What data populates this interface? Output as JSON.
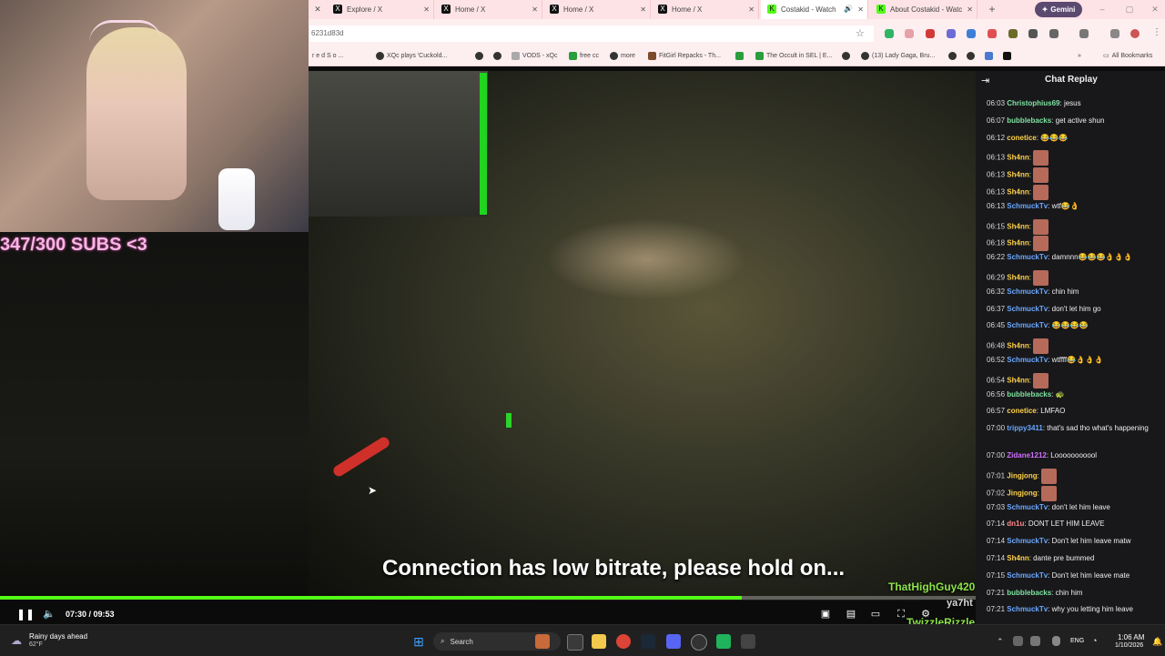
{
  "browser": {
    "tabs": [
      {
        "label": "Explore / X",
        "favicon": "x-icon"
      },
      {
        "label": "Home / X",
        "favicon": "x-icon"
      },
      {
        "label": "Home / X",
        "favicon": "x-icon"
      },
      {
        "label": "Home / X",
        "favicon": "x-icon"
      },
      {
        "label": "Costakid - Watch",
        "favicon": "kick-icon",
        "active": true
      },
      {
        "label": "About Costakid - Watc",
        "favicon": "kick-icon"
      }
    ],
    "gemini_label": "Gemini",
    "url_fragment": "6231d83d",
    "bookmarks": [
      "r e d   S o ...",
      "XQc plays 'Cuckold...",
      "VODS - xQc",
      "free cc",
      "more",
      "FitGirl Repacks - Th...",
      "The Occult in SEL | E...",
      "(13) Lady Gaga, Bru..."
    ],
    "all_bookmarks": "All Bookmarks"
  },
  "stream": {
    "subs_overlay": "347/300 SUBS <3",
    "caption": "Connection has low bitrate, please hold on...",
    "overlay_chatters": [
      "ThatHighGuy420",
      "ya7ht",
      "TwizzleRizzle"
    ],
    "time_current": "07:30",
    "time_total": "09:53",
    "time_display": "07:30 / 09:53",
    "progress_fraction": 0.76,
    "accent_color": "#53fc18"
  },
  "chat": {
    "title": "Chat Replay",
    "messages": [
      {
        "time": "06:03",
        "user": "Christophius69",
        "text": "jesus",
        "color": "#7fe3a0"
      },
      {
        "time": "06:07",
        "user": "bubblebacks",
        "text": "get active shun",
        "color": "#7fe3a0"
      },
      {
        "time": "06:12",
        "user": "conetice",
        "text": "😂😂😂",
        "color": "#ffd24a"
      },
      {
        "time": "06:13",
        "user": "Sh4nn",
        "text": "",
        "emote": true,
        "color": "#ffd24a"
      },
      {
        "time": "06:13",
        "user": "Sh4nn",
        "text": "",
        "emote": true,
        "color": "#ffd24a"
      },
      {
        "time": "06:13",
        "user": "Sh4nn",
        "text": "",
        "emote": true,
        "color": "#ffd24a"
      },
      {
        "time": "06:13",
        "user": "SchmuckTv",
        "text": "wtf😂👌",
        "color": "#6aa8ff"
      },
      {
        "time": "06:15",
        "user": "Sh4nn",
        "text": "",
        "emote": true,
        "color": "#ffd24a"
      },
      {
        "time": "06:18",
        "user": "Sh4nn",
        "text": "",
        "emote": true,
        "color": "#ffd24a"
      },
      {
        "time": "06:22",
        "user": "SchmuckTv",
        "text": "damnnn😂😂😂👌👌👌",
        "color": "#6aa8ff"
      },
      {
        "time": "06:29",
        "user": "Sh4nn",
        "text": "",
        "emote": true,
        "color": "#ffd24a"
      },
      {
        "time": "06:32",
        "user": "SchmuckTv",
        "text": "chin him",
        "color": "#6aa8ff"
      },
      {
        "time": "06:37",
        "user": "SchmuckTv",
        "text": "don't let him go",
        "color": "#6aa8ff"
      },
      {
        "time": "06:45",
        "user": "SchmuckTv",
        "text": "😂😂😂😂",
        "color": "#6aa8ff"
      },
      {
        "time": "06:48",
        "user": "Sh4nn",
        "text": "",
        "emote": true,
        "color": "#ffd24a"
      },
      {
        "time": "06:52",
        "user": "SchmuckTv",
        "text": "wtffff😂👌👌👌",
        "color": "#6aa8ff"
      },
      {
        "time": "06:54",
        "user": "Sh4nn",
        "text": "",
        "emote": true,
        "color": "#ffd24a"
      },
      {
        "time": "06:56",
        "user": "bubblebacks",
        "text": "🐢",
        "color": "#7fe3a0"
      },
      {
        "time": "06:57",
        "user": "conetice",
        "text": "LMFAO",
        "color": "#ffd24a"
      },
      {
        "time": "07:00",
        "user": "trippy3411",
        "text": "that's sad tho what's happening",
        "color": "#6aa8ff"
      },
      {
        "time": "07:00",
        "user": "Zidane1212",
        "text": "Looooooooool",
        "color": "#d070ff"
      },
      {
        "time": "07:01",
        "user": "Jingjong",
        "text": "",
        "emote": true,
        "color": "#ffd24a"
      },
      {
        "time": "07:02",
        "user": "Jingjong",
        "text": "",
        "emote": true,
        "color": "#ffd24a"
      },
      {
        "time": "07:03",
        "user": "SchmuckTv",
        "text": "don't let him leave",
        "color": "#6aa8ff"
      },
      {
        "time": "07:14",
        "user": "dn1u",
        "text": "DONT LET HIM LEAVE",
        "color": "#ff8a8a"
      },
      {
        "time": "07:14",
        "user": "SchmuckTv",
        "text": "Don't let him leave matw",
        "color": "#6aa8ff"
      },
      {
        "time": "07:14",
        "user": "Sh4nn",
        "text": "dante pre bummed",
        "color": "#ffd24a"
      },
      {
        "time": "07:15",
        "user": "SchmuckTv",
        "text": "Don't let him leave mate",
        "color": "#6aa8ff"
      },
      {
        "time": "07:21",
        "user": "bubblebacks",
        "text": "chin him",
        "color": "#7fe3a0"
      },
      {
        "time": "07:21",
        "user": "SchmuckTv",
        "text": "why you letting him leave",
        "color": "#6aa8ff"
      }
    ]
  },
  "taskbar": {
    "weather_line1": "Rainy days ahead",
    "weather_line2": "62°F",
    "search_label": "Search",
    "lang": "ENG",
    "time": "1:06 AM",
    "date": "1/10/2026"
  }
}
